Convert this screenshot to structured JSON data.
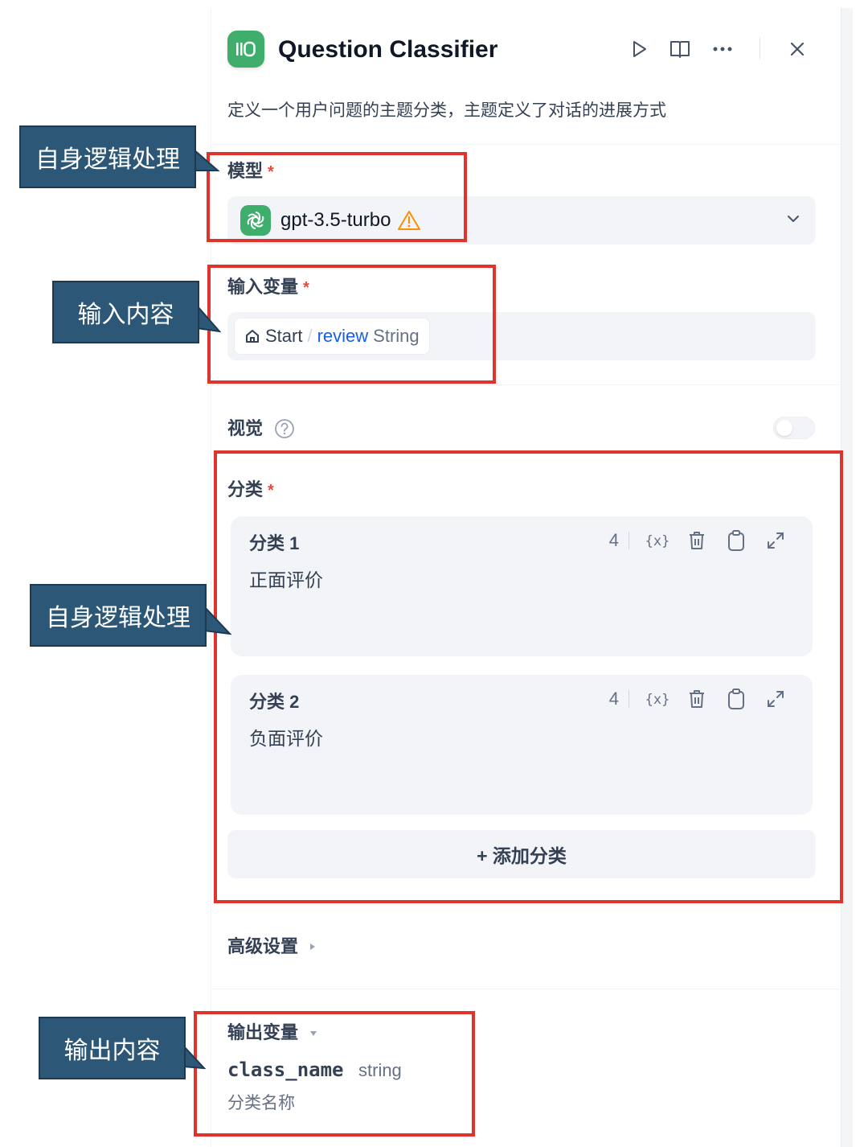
{
  "header": {
    "title": "Question Classifier",
    "description": "定义一个用户问题的主题分类，主题定义了对话的进展方式",
    "icons": [
      "classifier-icon",
      "run-icon",
      "book-icon",
      "more-icon",
      "close-icon"
    ]
  },
  "model": {
    "label": "模型",
    "required": "*",
    "name": "gpt-3.5-turbo"
  },
  "input": {
    "label": "输入变量",
    "required": "*",
    "source": "Start",
    "separator": "/",
    "variable": "review",
    "type": "String"
  },
  "vision": {
    "label": "视觉",
    "enabled": false
  },
  "classes": {
    "label": "分类",
    "required": "*",
    "items": [
      {
        "title": "分类 1",
        "text": "正面评价",
        "count": "4"
      },
      {
        "title": "分类 2",
        "text": "负面评价",
        "count": "4"
      }
    ],
    "add_label": "+ 添加分类"
  },
  "advanced": {
    "label": "高级设置"
  },
  "output": {
    "label": "输出变量",
    "var_name": "class_name",
    "var_type": "string",
    "var_desc": "分类名称"
  },
  "annotations": {
    "model_note": "自身逻辑处理",
    "input_note": "输入内容",
    "classes_note": "自身逻辑处理",
    "output_note": "输出内容"
  },
  "colors": {
    "accent_green": "#3fae6c",
    "variable_blue": "#155eef",
    "annotation_red": "#e0332c",
    "callout_bg": "#2d5776"
  }
}
